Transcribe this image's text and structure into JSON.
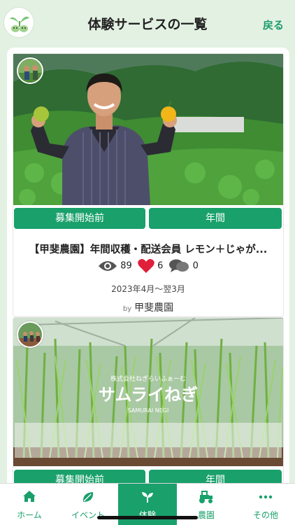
{
  "header": {
    "title": "体験サービスの一覧",
    "back_label": "戻る"
  },
  "services": [
    {
      "tags": [
        "募集開始前",
        "年間"
      ],
      "title": "【甲斐農園】年間収穫・配送会員 レモン＋じゃが...",
      "views": "89",
      "likes": "6",
      "comments": "0",
      "period": "2023年4月～翌3月",
      "by": "by",
      "farm": "甲斐農園"
    },
    {
      "tags": [
        "募集開始前",
        "年間"
      ],
      "photo_text": {
        "company": "株式会社ねぎらいふぁーむ",
        "brand": "サムライねぎ",
        "brand_en": "SAMURAI NEGI"
      }
    }
  ],
  "nav": {
    "items": [
      {
        "label": "ホーム",
        "icon": "home-icon"
      },
      {
        "label": "イベント",
        "icon": "leaf-icon"
      },
      {
        "label": "体験",
        "icon": "sprout-icon"
      },
      {
        "label": "農園",
        "icon": "tractor-icon"
      },
      {
        "label": "その他",
        "icon": "more-icon"
      }
    ],
    "active_index": 2
  },
  "colors": {
    "accent": "#19a06b",
    "header_bg": "#e3f1e3",
    "like": "#e0203a"
  }
}
